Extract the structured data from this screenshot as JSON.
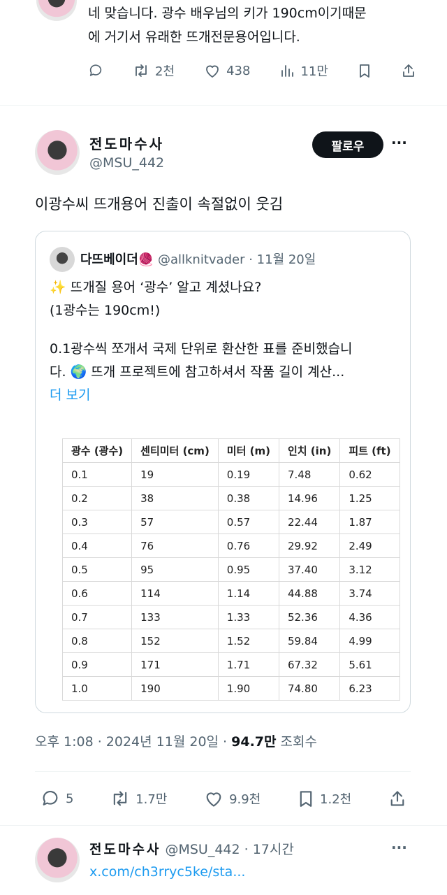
{
  "prev_reply": {
    "text_line1": "네 맞습니다. 광수 배우님의 키가 190cm이기때문",
    "text_line2": "에 거기서 유래한 뜨개전문용어입니다.",
    "actions": {
      "retweets": "2천",
      "likes": "438",
      "views": "11만"
    }
  },
  "main_tweet": {
    "display_name": "전도마수사",
    "handle": "@MSU_442",
    "follow_label": "팔로우",
    "more_label": "···",
    "text": "이광수씨 뜨개용어 진출이 속절없이 웃김",
    "timestamp": "오후 1:08 · 2024년 11월 20일 ·",
    "views_count": "94.7만",
    "views_label": "조회수",
    "actions": {
      "replies": "5",
      "retweets": "1.7만",
      "likes": "9.9천",
      "bookmarks": "1.2천"
    }
  },
  "quote": {
    "display_name": "다뜨베이더",
    "name_emoji": "🧶",
    "handle": "@allknitvader",
    "date": "· 11월 20일",
    "line1_emoji": "✨",
    "line1": "뜨개질 용어 ‘광수’ 알고 계셨나요?",
    "line2": "(1광수는 190cm!)",
    "line3": "0.1광수씩 쪼개서 국제 단위로 환산한 표를 준비했습니",
    "line4_prefix": "다.",
    "line4_emoji": "🌍",
    "line4_rest": "뜨개 프로젝트에 참고하셔서 작품 길이 계산...",
    "show_more": "더 보기",
    "table": {
      "headers": [
        "광수 (광수)",
        "센티미터 (cm)",
        "미터 (m)",
        "인치 (in)",
        "피트 (ft)"
      ],
      "rows": [
        [
          "0.1",
          "19",
          "0.19",
          "7.48",
          "0.62"
        ],
        [
          "0.2",
          "38",
          "0.38",
          "14.96",
          "1.25"
        ],
        [
          "0.3",
          "57",
          "0.57",
          "22.44",
          "1.87"
        ],
        [
          "0.4",
          "76",
          "0.76",
          "29.92",
          "2.49"
        ],
        [
          "0.5",
          "95",
          "0.95",
          "37.40",
          "3.12"
        ],
        [
          "0.6",
          "114",
          "1.14",
          "44.88",
          "3.74"
        ],
        [
          "0.7",
          "133",
          "1.33",
          "52.36",
          "4.36"
        ],
        [
          "0.8",
          "152",
          "1.52",
          "59.84",
          "4.99"
        ],
        [
          "0.9",
          "171",
          "1.71",
          "67.32",
          "5.61"
        ],
        [
          "1.0",
          "190",
          "1.90",
          "74.80",
          "6.23"
        ]
      ]
    }
  },
  "reply": {
    "display_name": "전도마수사",
    "handle": "@MSU_442",
    "time": "· 17시간",
    "link": "x.com/ch3rryc5ke/sta...",
    "more_label": "···"
  },
  "colors": {
    "link": "#1d9bf0",
    "muted": "#536471",
    "text": "#0f1419"
  }
}
